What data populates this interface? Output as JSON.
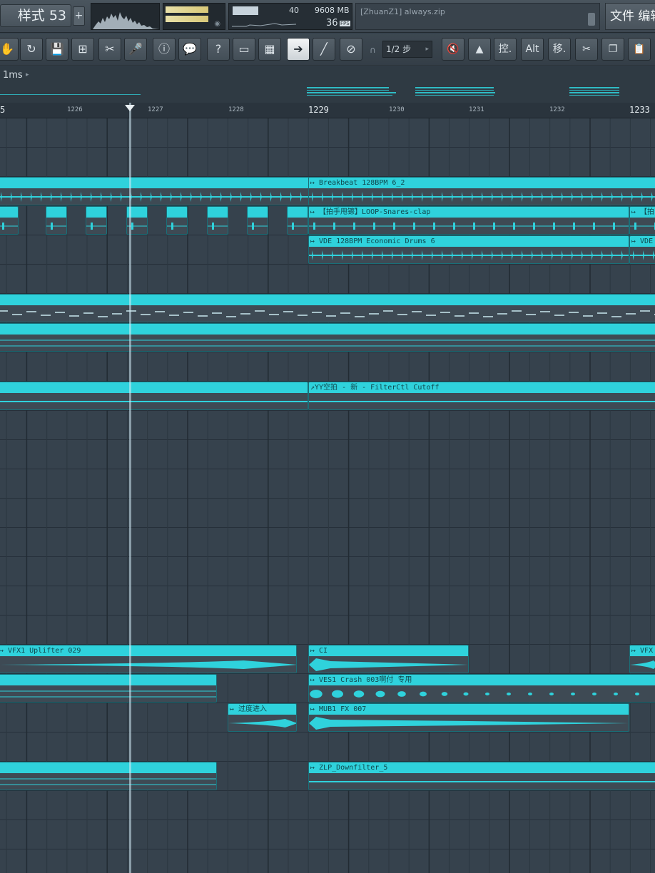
{
  "topbar": {
    "pattern_label": "样式 53",
    "add_pattern": "+",
    "cpu_value": "40",
    "memory": "9608 MB",
    "polyphony": "36",
    "fps_badge": "FPS",
    "hint_text": "[ZhuanZ1] always.zip",
    "menu_label": "文件 编辑"
  },
  "toolbar": {
    "buttons": [
      {
        "name": "hand-icon",
        "glyph": "✋"
      },
      {
        "name": "loop-icon",
        "glyph": "↻"
      },
      {
        "name": "save-icon",
        "glyph": "💾"
      },
      {
        "name": "marker-icon",
        "glyph": "⊞"
      },
      {
        "name": "cut-icon",
        "glyph": "✂"
      },
      {
        "name": "mic-icon",
        "glyph": "🎤"
      },
      {
        "name": "info-icon",
        "glyph": "ⓘ"
      },
      {
        "name": "chat-icon",
        "glyph": "💬"
      },
      {
        "name": "help-icon",
        "glyph": "?"
      },
      {
        "name": "browser-icon",
        "glyph": "▭"
      },
      {
        "name": "piano-icon",
        "glyph": "▦"
      },
      {
        "name": "arrow-icon",
        "glyph": "➔"
      },
      {
        "name": "brush-icon",
        "glyph": "╱"
      },
      {
        "name": "link-icon",
        "glyph": "⊘"
      }
    ],
    "snap_label": "1/2 步",
    "right_buttons": [
      {
        "name": "mute-icon",
        "glyph": "🔇"
      },
      {
        "name": "stamp-icon",
        "glyph": "▲"
      },
      {
        "name": "control-button",
        "glyph": "控."
      },
      {
        "name": "alt-button",
        "glyph": "Alt"
      },
      {
        "name": "move-button",
        "glyph": "移."
      },
      {
        "name": "scissors-icon",
        "glyph": "✂"
      },
      {
        "name": "copy-icon",
        "glyph": "❐"
      },
      {
        "name": "paste-icon",
        "glyph": "📋"
      }
    ]
  },
  "info": {
    "time_label": "1ms"
  },
  "ruler": {
    "bars": [
      "5",
      "1226",
      "1227",
      "1228",
      "1229",
      "1230",
      "1231",
      "1232",
      "1233"
    ]
  },
  "clips": {
    "breakbeat": "↦ Breakbeat 128BPM 6_2",
    "snares": "↦ 【拍手甩镲】LOOP-Snares-clap",
    "snares_short": "↦ 【拍",
    "vde": "↦ VDE 128BPM Economic Drums 6",
    "vde_short": "↦ VDE",
    "filter": "↗YY空拍 - 新 - FilterCtl Cutoff",
    "vfx": "↦ VFX1 Uplifter 029",
    "ci": "↦ CI",
    "vfx_short": "↦ VFX",
    "crash": "↦ VES1 Crash 003啊付 专用",
    "transition": "↦ 过度进入",
    "mub": "↦ MUB1 FX 007",
    "zlp": "↦ ZLP_Downfilter_5"
  },
  "colors": {
    "clip": "#2fd2dc",
    "clip_dark": "#1a6f78",
    "bg": "#36424d"
  }
}
